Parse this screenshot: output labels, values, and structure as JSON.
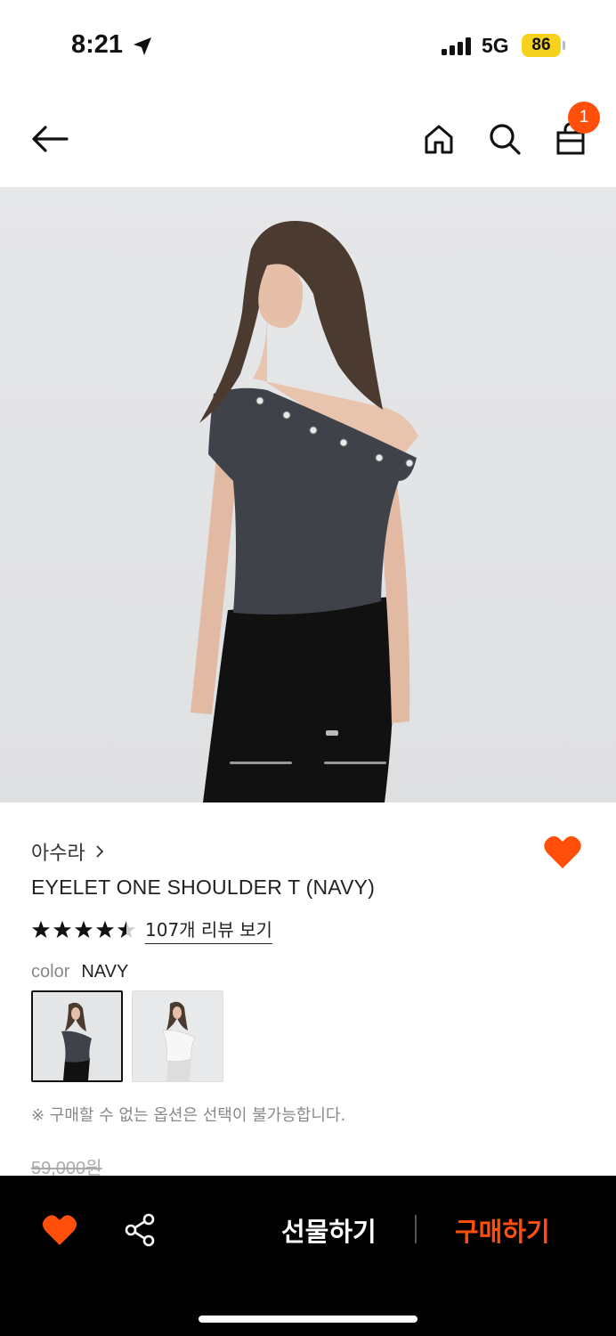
{
  "status_bar": {
    "time": "8:21",
    "network": "5G",
    "battery": "86"
  },
  "header": {
    "back_icon": "arrow-left-icon",
    "home_icon": "home-icon",
    "search_icon": "search-icon",
    "cart_icon": "shopping-bag-icon",
    "cart_badge": "1"
  },
  "gallery": {
    "image": "model wearing navy one-shoulder top",
    "pages": 3,
    "current_page": 2
  },
  "product": {
    "brand": "아수라",
    "title": "EYELET ONE SHOULDER T (NAVY)",
    "rating": 4.5,
    "review_link": "107개 리뷰 보기",
    "color_label": "color",
    "color_value": "NAVY",
    "swatches": [
      {
        "color": "navy",
        "selected": true
      },
      {
        "color": "white",
        "selected": false
      }
    ],
    "notice": "※ 구매할 수 없는 옵션은 선택이 불가능합니다.",
    "original_price": "59,000원",
    "wishlisted": true
  },
  "bottom_bar": {
    "gift_label": "선물하기",
    "buy_label": "구매하기",
    "heart_icon": "heart-icon",
    "share_icon": "share-icon"
  },
  "colors": {
    "accent": "#ff4f0a",
    "bar": "#000000"
  }
}
